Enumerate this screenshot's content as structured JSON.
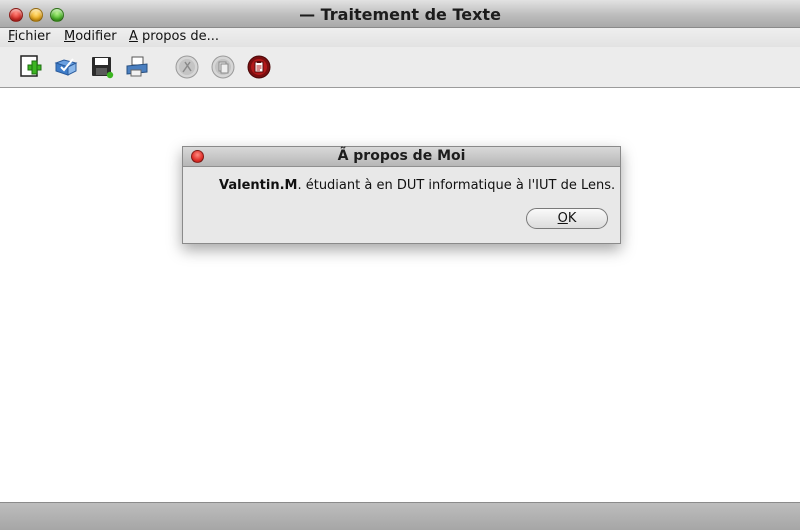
{
  "window": {
    "title": "— Traitement de Texte"
  },
  "menu": {
    "items": [
      {
        "mnemonic": "F",
        "rest": "ichier"
      },
      {
        "mnemonic": "M",
        "rest": "odifier"
      },
      {
        "mnemonic": "A",
        "rest": " propos de..."
      }
    ]
  },
  "toolbar": {
    "buttons": [
      {
        "icon": "new-document-icon"
      },
      {
        "icon": "open-icon"
      },
      {
        "icon": "save-icon"
      },
      {
        "icon": "print-icon"
      },
      {
        "icon": "cut-icon",
        "enabled": false
      },
      {
        "icon": "copy-icon",
        "enabled": false
      },
      {
        "icon": "paste-icon"
      }
    ]
  },
  "dialog": {
    "title": "Ã  propos de Moi",
    "message_bold": "Valentin.M",
    "message_rest": ". étudiant à en DUT informatique à l'IUT de Lens.",
    "ok_mnemonic": "O",
    "ok_rest": "K"
  },
  "colors": {
    "close": "#e0302a",
    "minimize": "#f5b21d",
    "maximize": "#4fbf2b",
    "add_green": "#3cb521",
    "paste_red": "#b3191a"
  }
}
